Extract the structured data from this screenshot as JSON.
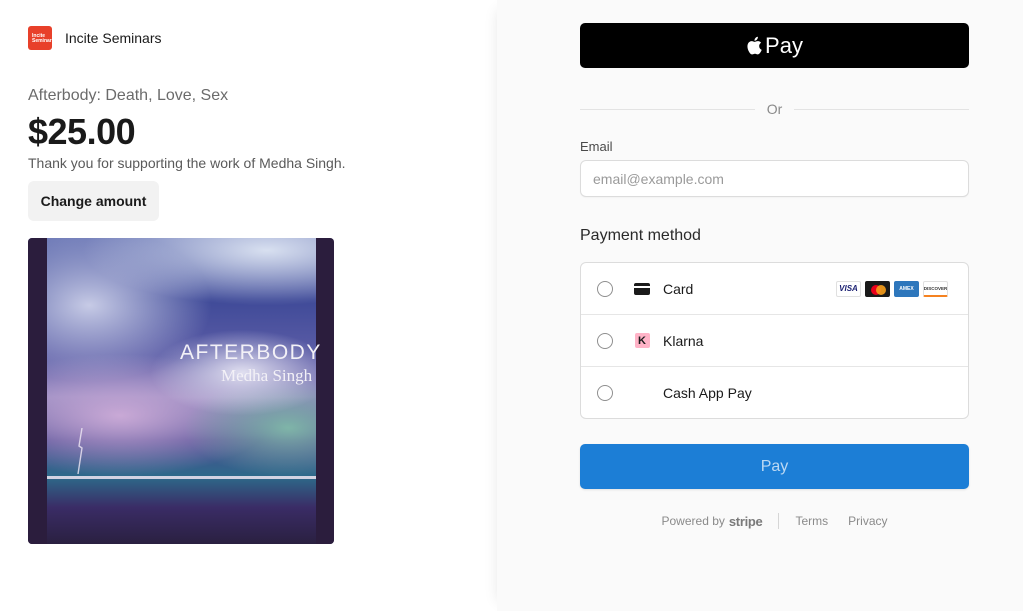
{
  "merchant": {
    "name": "Incite Seminars",
    "logo_text": "Incite Seminars"
  },
  "product": {
    "name": "Afterbody: Death, Love, Sex",
    "price": "$25.00",
    "thanks": "Thank you for supporting the work of Medha Singh.",
    "change_amount_label": "Change amount",
    "cover": {
      "title": "AFTERBODY",
      "author": "Medha Singh"
    }
  },
  "checkout": {
    "apple_pay_label": "Pay",
    "or_text": "Or",
    "email": {
      "label": "Email",
      "placeholder": "email@example.com",
      "value": ""
    },
    "payment_method_heading": "Payment method",
    "methods": [
      {
        "label": "Card",
        "icon": "card-icon",
        "selected": false
      },
      {
        "label": "Klarna",
        "icon": "klarna-icon",
        "selected": false
      },
      {
        "label": "Cash App Pay",
        "icon": "",
        "selected": false
      }
    ],
    "card_brands": {
      "visa": "VISA",
      "amex": "AMEX",
      "discover": "DISCOVER"
    },
    "pay_label": "Pay"
  },
  "footer": {
    "powered_by": "Powered by",
    "stripe": "stripe",
    "terms": "Terms",
    "privacy": "Privacy"
  },
  "colors": {
    "pay_button": "#1c7ed6",
    "apple_pay": "#000000",
    "brand_logo": "#e8402a"
  }
}
